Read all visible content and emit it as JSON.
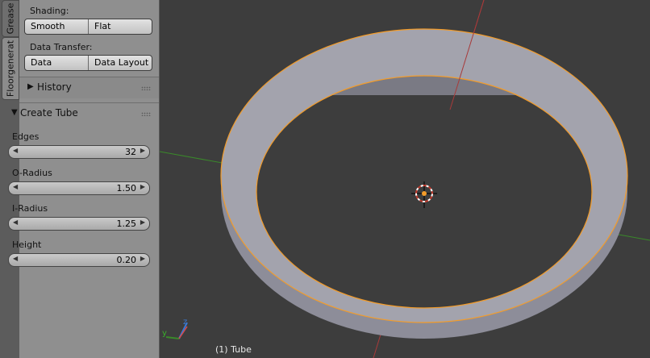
{
  "tabs": [
    {
      "label": "Grease"
    },
    {
      "label": "Floorgenerat"
    }
  ],
  "shading": {
    "label": "Shading:",
    "smooth": "Smooth",
    "flat": "Flat"
  },
  "data_transfer": {
    "label": "Data Transfer:",
    "data": "Data",
    "data_layout": "Data Layout"
  },
  "history": {
    "title": "History",
    "arrow": "▶"
  },
  "create_tube": {
    "title": "Create Tube",
    "arrow": "▼",
    "fields": [
      {
        "label": "Edges",
        "value": "32"
      },
      {
        "label": "O-Radius",
        "value": "1.50"
      },
      {
        "label": "I-Radius",
        "value": "1.25"
      },
      {
        "label": "Height",
        "value": "0.20"
      }
    ]
  },
  "viewport": {
    "object_label": "(1) Tube",
    "axis_x": "x",
    "axis_y": "y",
    "axis_z": "z"
  },
  "colors": {
    "viewport_bg": "#3d3d3d",
    "mesh": "#9f9faa",
    "selection": "#f39c2a",
    "x_axis": "#a83a3a",
    "y_axis": "#3a8a2a"
  }
}
